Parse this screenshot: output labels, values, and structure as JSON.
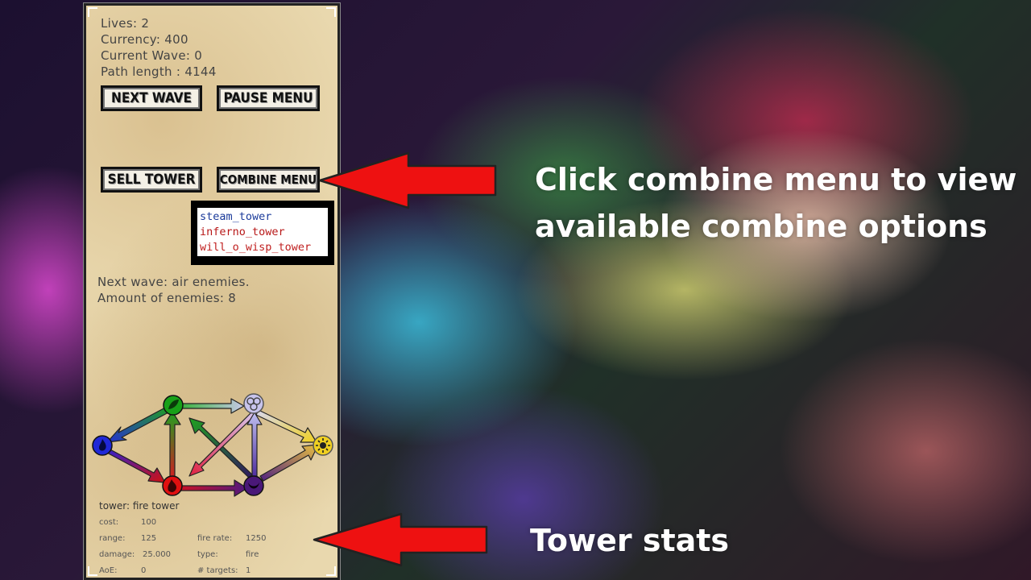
{
  "hud": {
    "lives": "Lives: 2",
    "currency": "Currency: 400",
    "current_wave": "Current Wave: 0",
    "path_length": "Path length : 4144"
  },
  "buttons": {
    "next_wave": "NEXT WAVE",
    "pause_menu": "PAUSE MENU",
    "sell_tower": "SELL TOWER",
    "combine_menu": "COMBINE MENU"
  },
  "combine_options": [
    {
      "label": "steam_tower",
      "color": "#1a3a9a"
    },
    {
      "label": "inferno_tower",
      "color": "#b81818"
    },
    {
      "label": "will_o_wisp_tower",
      "color": "#c02020"
    }
  ],
  "wave_info": {
    "next_wave": "Next wave: air enemies.",
    "amount": "Amount of enemies: 8"
  },
  "element_icons": [
    "nature-icon",
    "air-icon",
    "light-icon",
    "water-icon",
    "fire-icon",
    "dark-icon"
  ],
  "tower_stats": {
    "tower": "tower: fire tower",
    "cost_label": "cost:",
    "cost_value": "100",
    "range_label": "range:",
    "range_value": "125",
    "fire_rate_label": "fire rate:",
    "fire_rate_value": "1250",
    "damage_label": "damage:",
    "damage_value": "25.000",
    "type_label": "type:",
    "type_value": "fire",
    "aoe_label": "AoE:",
    "aoe_value": "0",
    "targets_label": "# targets:",
    "targets_value": "1"
  },
  "annotations": {
    "combine_line1": "Click combine menu to view",
    "combine_line2": "available combine options",
    "stats": "Tower stats"
  },
  "colors": {
    "arrow_red": "#ee1111",
    "panel_parchment": "#e9d8ae"
  }
}
